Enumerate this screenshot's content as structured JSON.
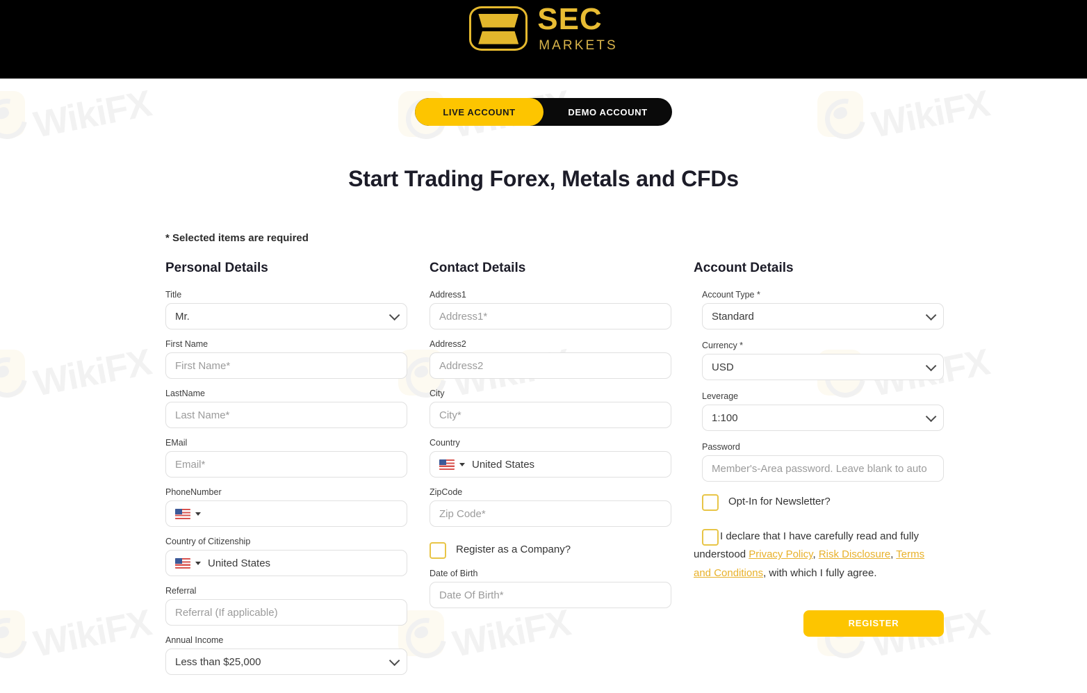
{
  "brand": {
    "name_primary": "SEC",
    "name_secondary": "MARKETS",
    "logo_color": "#E8BC33",
    "accent_color": "#FDC500",
    "header_bg": "#000000"
  },
  "watermark": {
    "text": "WikiFX"
  },
  "tabs": [
    {
      "label": "LIVE ACCOUNT",
      "active": true
    },
    {
      "label": "DEMO ACCOUNT",
      "active": false
    }
  ],
  "page_title": "Start Trading Forex, Metals and CFDs",
  "required_note": "* Selected items are required",
  "personal_details": {
    "heading": "Personal Details",
    "title": {
      "label": "Title",
      "value": "Mr."
    },
    "first_name": {
      "label": "First Name",
      "placeholder": "First Name*"
    },
    "last_name": {
      "label": "LastName",
      "placeholder": "Last Name*"
    },
    "email": {
      "label": "EMail",
      "placeholder": "Email*"
    },
    "phone_number": {
      "label": "PhoneNumber",
      "value": "",
      "flag": "us-flag-icon"
    },
    "country_of_citizenship": {
      "label": "Country of Citizenship",
      "value": "United States",
      "flag": "us-flag-icon"
    },
    "referral": {
      "label": "Referral",
      "placeholder": "Referral (If applicable)"
    },
    "annual_income": {
      "label": "Annual Income",
      "value": "Less than $25,000"
    }
  },
  "contact_details": {
    "heading": "Contact Details",
    "address1": {
      "label": "Address1",
      "placeholder": "Address1*"
    },
    "address2": {
      "label": "Address2",
      "placeholder": "Address2"
    },
    "city": {
      "label": "City",
      "placeholder": "City*"
    },
    "country": {
      "label": "Country",
      "value": "United States",
      "flag": "us-flag-icon"
    },
    "zipcode": {
      "label": "ZipCode",
      "placeholder": "Zip Code*"
    },
    "register_company": {
      "label": "Register as a Company?",
      "checked": false
    },
    "date_of_birth": {
      "label": "Date of Birth",
      "placeholder": "Date Of Birth*"
    }
  },
  "account_details": {
    "heading": "Account Details",
    "account_type": {
      "label": "Account Type *",
      "value": "Standard"
    },
    "currency": {
      "label": "Currency *",
      "value": "USD"
    },
    "leverage": {
      "label": "Leverage",
      "value": "1:100"
    },
    "password": {
      "label": "Password",
      "placeholder": "Member's-Area password. Leave blank to auto"
    },
    "newsletter": {
      "label": "Opt-In for Newsletter?",
      "checked": false
    },
    "declaration": {
      "checked": false,
      "part1": "I declare that I have carefully read and fully understood ",
      "link1": "Privacy Policy",
      "sep1": ", ",
      "link2": "Risk Disclosure",
      "sep2": ", ",
      "link3": "Terms and Conditions",
      "part2": ", with which I fully agree."
    },
    "register_button": "REGISTER"
  }
}
